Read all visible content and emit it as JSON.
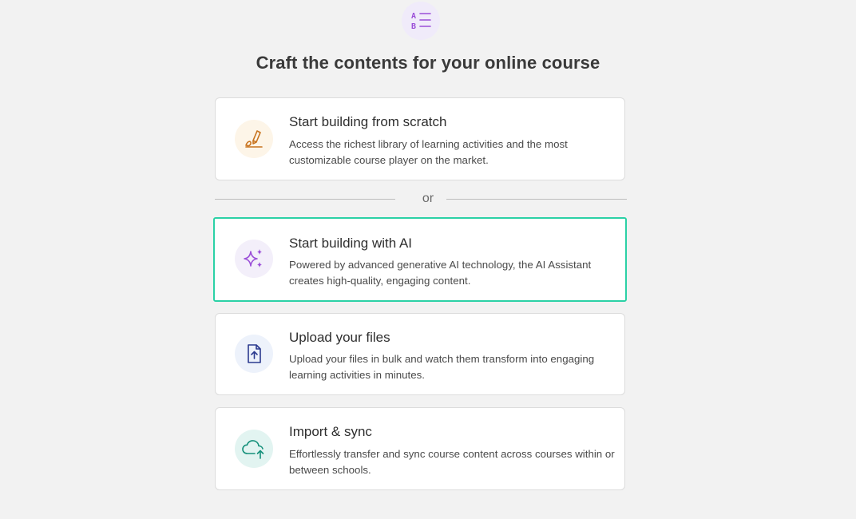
{
  "header": {
    "icon": "ab-list-icon",
    "title": "Craft the contents for your online course"
  },
  "divider": {
    "text": "or"
  },
  "options": [
    {
      "title": "Start building from scratch",
      "description": "Access the richest library of learning activities and the most customizable course player on the market.",
      "icon": "pencil-draw-icon",
      "icon_color": "#c8731e",
      "icon_bg": "#fdf5e8",
      "selected": false
    },
    {
      "title": "Start building with AI",
      "description": "Powered by advanced generative AI technology, the AI Assistant creates high-quality, engaging content.",
      "icon": "sparkles-icon",
      "icon_color": "#9b4fd8",
      "icon_bg": "#f3effa",
      "selected": true
    },
    {
      "title": "Upload your files",
      "description": "Upload your files in bulk and watch them transform into engaging learning activities in minutes.",
      "icon": "file-upload-icon",
      "icon_color": "#2b3a8f",
      "icon_bg": "#edf2fb",
      "selected": false
    },
    {
      "title": "Import & sync",
      "description": "Effortlessly transfer and sync course content across courses within or between schools.",
      "icon": "cloud-upload-icon",
      "icon_color": "#14907a",
      "icon_bg": "#e2f4f1",
      "selected": false
    }
  ],
  "colors": {
    "selected_border": "#2bd1a6",
    "header_icon": "#9b4fd8"
  }
}
